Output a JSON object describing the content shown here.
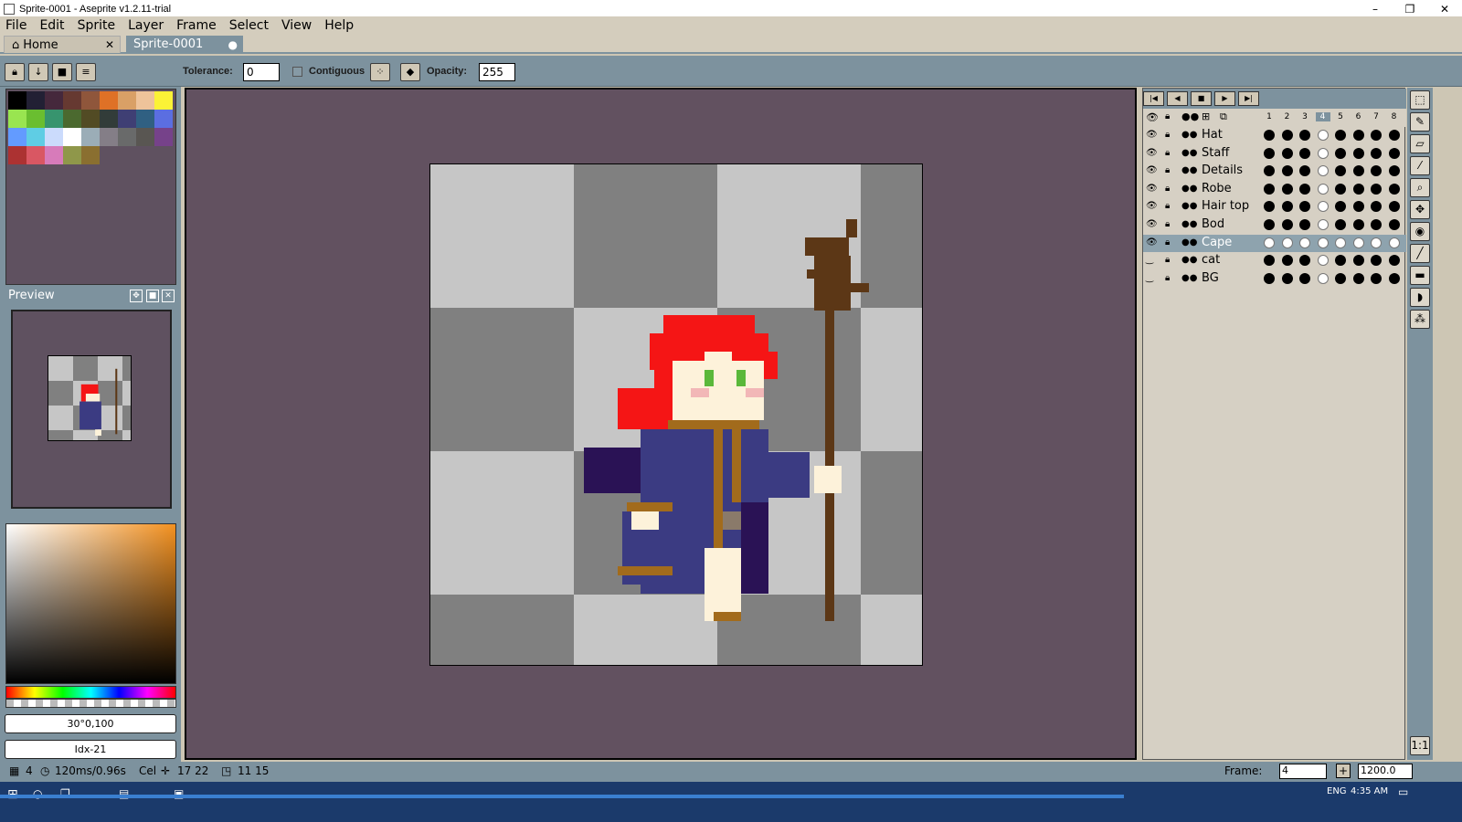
{
  "window": {
    "title": "Sprite-0001 - Aseprite v1.2.11-trial",
    "min": "–",
    "max": "❐",
    "close": "✕"
  },
  "menu": [
    "File",
    "Edit",
    "Sprite",
    "Layer",
    "Frame",
    "Select",
    "View",
    "Help"
  ],
  "tabs": [
    {
      "label": "Home",
      "close": "✕"
    },
    {
      "label": "Sprite-0001",
      "close": "●"
    }
  ],
  "toolbar": {
    "tolerance_label": "Tolerance:",
    "tolerance_value": "0",
    "contiguous_label": "Contiguous",
    "opacity_label": "Opacity:",
    "opacity_value": "255"
  },
  "preview": {
    "title": "Preview"
  },
  "color_fields": {
    "hsv": "30°0,100",
    "index": "Idx-21"
  },
  "palette_colors": [
    "#000000",
    "#222034",
    "#45283c",
    "#663931",
    "#8f563b",
    "#df7126",
    "#d9a066",
    "#eec39a",
    "#fbf236",
    "#99e550",
    "#6abe30",
    "#37946e",
    "#4b692f",
    "#524b24",
    "#323c39",
    "#3f3f74",
    "#306082",
    "#5b6ee1",
    "#639bff",
    "#5fcde4",
    "#cbdbfc",
    "#ffffff",
    "#9badb7",
    "#847e87",
    "#696a6a",
    "#595652",
    "#76428a",
    "#ac3232",
    "#d95763",
    "#d77bba",
    "#8f974a",
    "#8a6f30"
  ],
  "layers": [
    {
      "name": "Hat",
      "visible": true,
      "selected": false
    },
    {
      "name": "Staff",
      "visible": true,
      "selected": false
    },
    {
      "name": "Details",
      "visible": true,
      "selected": false
    },
    {
      "name": "Robe",
      "visible": true,
      "selected": false
    },
    {
      "name": "Hair top",
      "visible": true,
      "selected": false
    },
    {
      "name": "Bod",
      "visible": true,
      "selected": false
    },
    {
      "name": "Cape",
      "visible": true,
      "selected": true
    },
    {
      "name": "cat",
      "visible": false,
      "selected": false
    },
    {
      "name": "BG",
      "visible": false,
      "selected": false
    }
  ],
  "frames": [
    "1",
    "2",
    "3",
    "4",
    "5",
    "6",
    "7",
    "8"
  ],
  "current_frame": "4",
  "status": {
    "frame": "4",
    "duration": "120ms/0.96s",
    "cel_label": "Cel",
    "cel_pos": "17 22",
    "cel_size": "11 15",
    "frame_label": "Frame:",
    "frame_value": "4",
    "zoom": "1200.0"
  },
  "taskbar": {
    "lang": "ENG",
    "time": "4:35 AM"
  },
  "colors": {
    "ui_blue": "#7d929e",
    "canvas_bg": "#625160",
    "hair": "#f51515",
    "robe": "#3b3b82",
    "robe_dark": "#2a1255",
    "trim": "#a26b1c",
    "skin": "#fdf2da",
    "staff": "#5c3716"
  }
}
